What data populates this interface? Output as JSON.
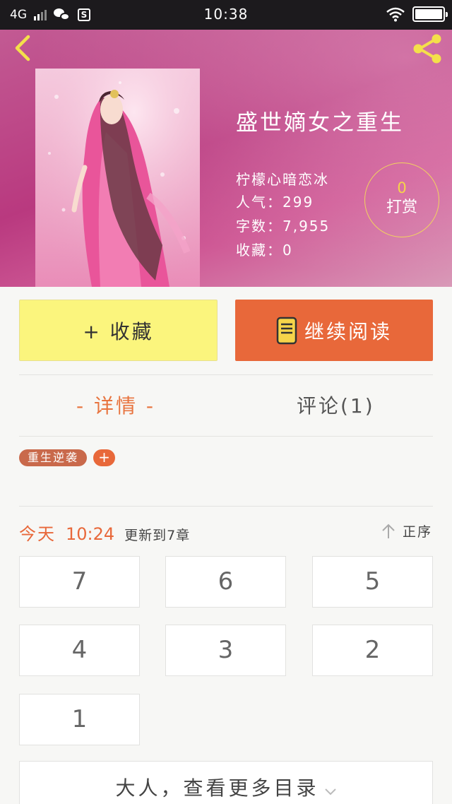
{
  "status_bar": {
    "network": "4G",
    "time": "10:38",
    "s_badge": "S",
    "icons": [
      "signal-icon",
      "wechat-icon",
      "s-app-icon",
      "wifi-icon",
      "battery-icon"
    ]
  },
  "header": {
    "back_icon": "chevron-left-icon",
    "share_icon": "share-icon",
    "book_title": "盛世嫡女之重生",
    "author": "柠檬心暗恋冰",
    "popularity": "人气：299",
    "word_count": "字数：7,955",
    "favorites": "收藏：0",
    "tip": {
      "count": "0",
      "label": "打赏"
    }
  },
  "actions": {
    "collect_label": "+ 收藏",
    "read_label": "继续阅读",
    "read_icon": "book-icon"
  },
  "tabs": [
    {
      "label": "- 详情 -",
      "active": true
    },
    {
      "label": "评论(1)",
      "active": false
    }
  ],
  "tags": [
    "重生逆袭",
    "+"
  ],
  "update": {
    "day": "今天",
    "time": "10:24",
    "text": "更新到7章",
    "sort_label": "正序",
    "sort_icon": "arrow-up-icon"
  },
  "chapters": [
    "7",
    "6",
    "5",
    "4",
    "3",
    "2",
    "1"
  ],
  "more": {
    "label": "大人，查看更多目录",
    "icon": "chevron-down-icon"
  },
  "colors": {
    "accent_orange": "#e8683a",
    "collect_yellow": "#fbf57d",
    "tag_brown": "#c9694b",
    "tip_gold": "#f2d35e"
  }
}
